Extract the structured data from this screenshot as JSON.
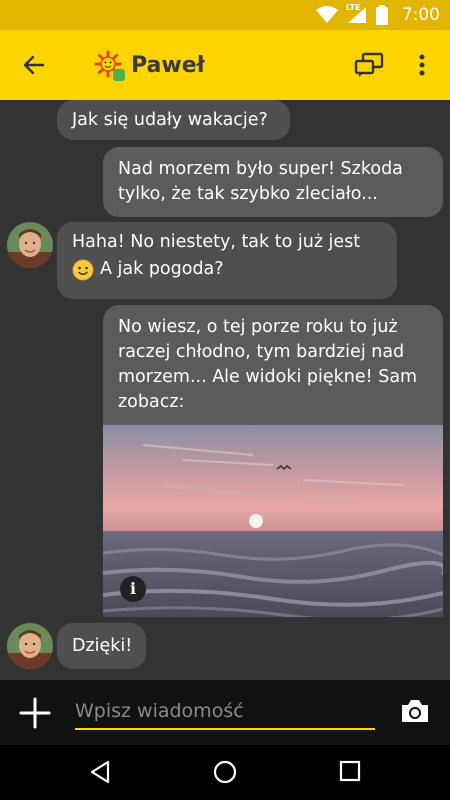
{
  "status": {
    "time": "7:00",
    "network": "LTE"
  },
  "header": {
    "contact_name": "Paweł"
  },
  "messages": [
    {
      "text": "Jak się udały wakacje?"
    },
    {
      "text": "Nad morzem było super! Szkoda tylko, że tak szybko zleciało..."
    },
    {
      "text": "Haha! No niestety, tak to już jest",
      "text2": "A jak pogoda?"
    },
    {
      "text": "No wiesz, o tej porze roku to już raczej chłodno, tym bardziej nad morzem... Ale widoki piękne! Sam zobacz:"
    },
    {
      "text": "Dzięki!"
    }
  ],
  "input": {
    "placeholder": "Wpisz wiadomość"
  },
  "colors": {
    "accent": "#ffd400",
    "status_bar": "#e2b500",
    "bubble": "#5b5b5b",
    "background": "#333333"
  }
}
